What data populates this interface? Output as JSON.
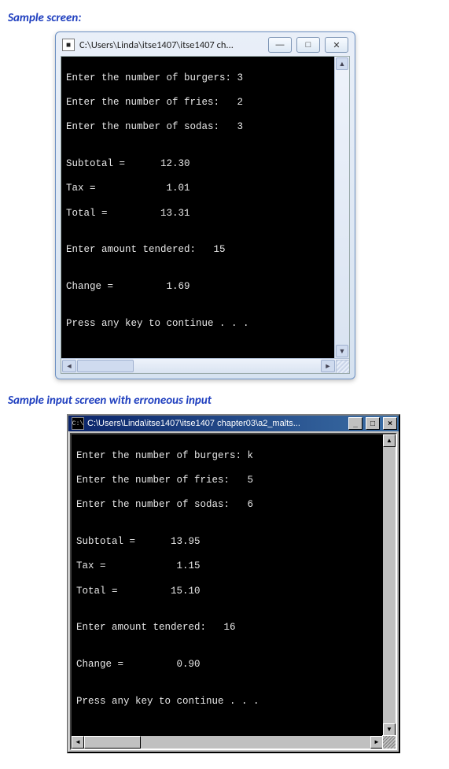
{
  "caption1": "Sample screen:",
  "caption2": "Sample input screen with erroneous input",
  "window1": {
    "title": "C:\\Users\\Linda\\itse1407\\itse1407 ch...",
    "lines": [
      "Enter the number of burgers: 3",
      "Enter the number of fries:   2",
      "Enter the number of sodas:   3",
      "",
      "Subtotal =      12.30",
      "Tax =            1.01",
      "Total =         13.31",
      "",
      "Enter amount tendered:   15",
      "",
      "Change =         1.69",
      "",
      "Press any key to continue . . ."
    ]
  },
  "window2": {
    "title": "C:\\Users\\Linda\\itse1407\\itse1407 chapter03\\a2_malts...",
    "lines": [
      "Enter the number of burgers: k",
      "Enter the number of fries:   5",
      "Enter the number of sodas:   6",
      "",
      "Subtotal =      13.95",
      "Tax =            1.15",
      "Total =         15.10",
      "",
      "Enter amount tendered:   16",
      "",
      "Change =         0.90",
      "",
      "Press any key to continue . . ."
    ]
  },
  "icons": {
    "min": "—",
    "max": "□",
    "close": "✕",
    "up": "▲",
    "down": "▼",
    "left": "◄",
    "right": "►",
    "cmd": "C:\\",
    "app": "■"
  }
}
